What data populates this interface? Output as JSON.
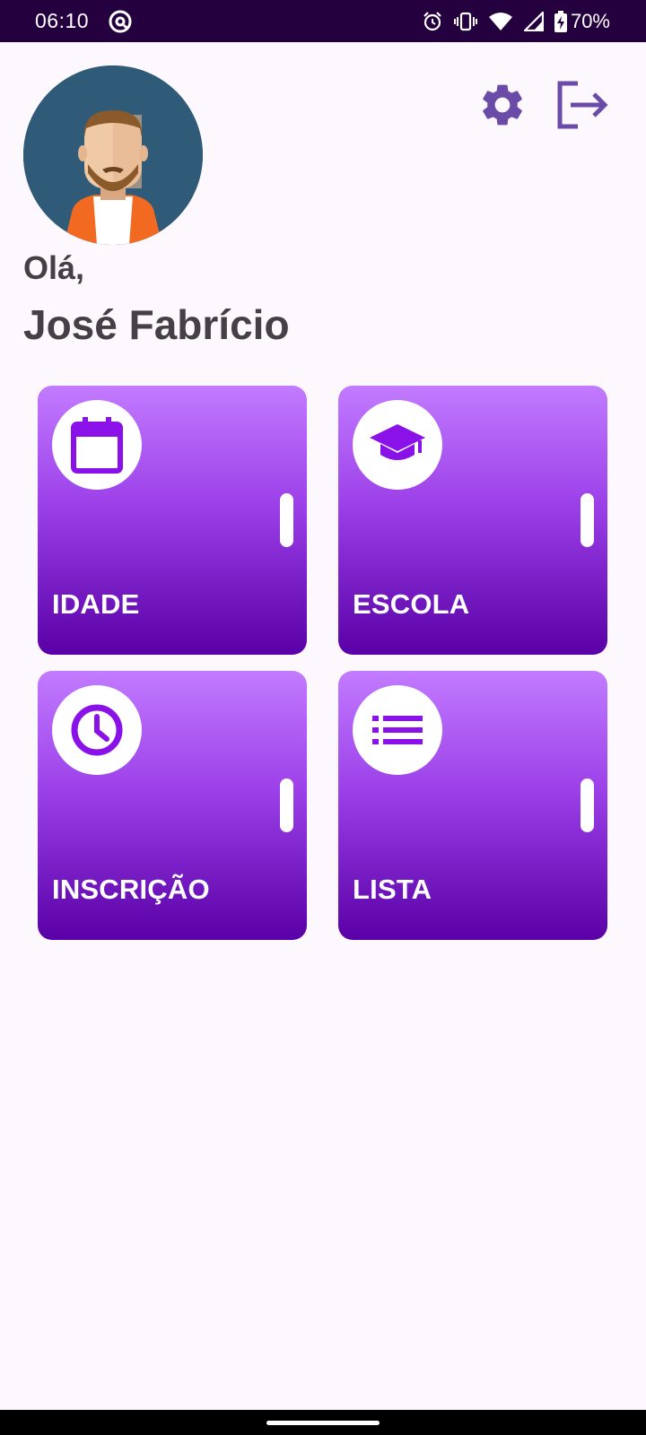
{
  "status_bar": {
    "time": "06:10",
    "battery": "70%",
    "icons": [
      "at-sign-icon",
      "alarm-icon",
      "vibrate-icon",
      "wifi-icon",
      "signal-icon",
      "battery-charging-icon"
    ]
  },
  "header": {
    "avatar_icon": "user-avatar-icon",
    "settings_icon": "gear-icon",
    "logout_icon": "logout-icon"
  },
  "greeting": {
    "hello": "Olá,",
    "name": "José Fabrício"
  },
  "tiles": [
    {
      "label": "IDADE",
      "icon": "calendar-icon"
    },
    {
      "label": "ESCOLA",
      "icon": "graduation-cap-icon"
    },
    {
      "label": "INSCRIÇÃO",
      "icon": "clock-icon"
    },
    {
      "label": "LISTA",
      "icon": "list-icon"
    }
  ],
  "colors": {
    "status_bar": "#24003f",
    "accent_icon": "#6a4ca8",
    "tile_top": "#c27bff",
    "tile_bottom": "#5900a6",
    "tile_icon": "#8a12e8",
    "text_dark": "#444046",
    "background": "#fdf8fd"
  }
}
